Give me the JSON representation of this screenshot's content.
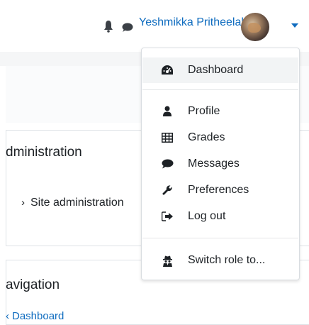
{
  "header": {
    "user_name": "Yeshmikka Pritheelal",
    "icons": [
      "bell-icon",
      "chat-icon",
      "caret-down-icon"
    ],
    "accent": "#0f6cbf"
  },
  "left": {
    "admin_section_title": "dministration",
    "site_admin_label": "Site administration",
    "navigation_section_title": "avigation",
    "dashboard_link": "Dashboard"
  },
  "user_menu": {
    "items": [
      {
        "label": "Dashboard",
        "icon": "dashboard-icon"
      },
      {
        "label": "Profile",
        "icon": "user-icon"
      },
      {
        "label": "Grades",
        "icon": "table-icon"
      },
      {
        "label": "Messages",
        "icon": "chat-icon"
      },
      {
        "label": "Preferences",
        "icon": "wrench-icon"
      },
      {
        "label": "Log out",
        "icon": "sign-out-icon"
      },
      {
        "label": "Switch role to...",
        "icon": "user-secret-icon"
      }
    ]
  }
}
